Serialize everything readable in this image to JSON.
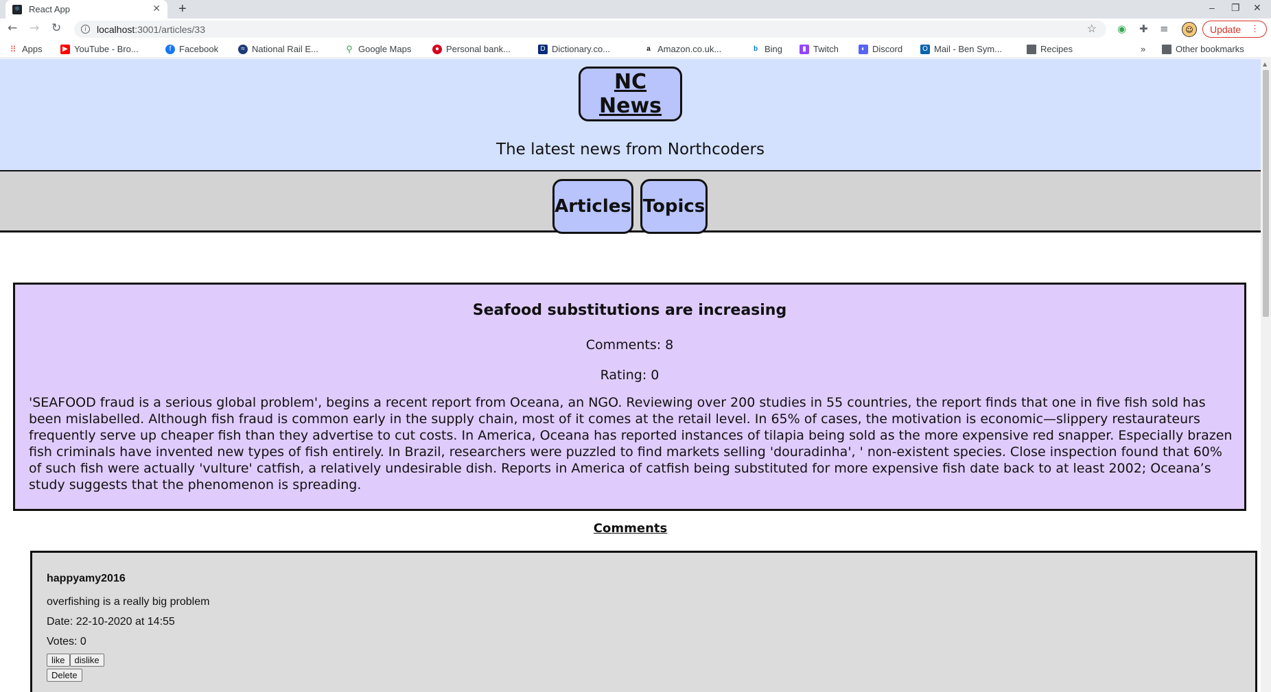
{
  "browser": {
    "tab_title": "React App",
    "url_host": "localhost",
    "url_rest": ":3001/articles/33",
    "update_label": "Update",
    "bookmarks": [
      {
        "label": "Apps",
        "icon": "apps-grid-icon",
        "color": "#4285f4"
      },
      {
        "label": "YouTube - Bro...",
        "icon": "youtube-icon",
        "color": "#ff0000"
      },
      {
        "label": "Facebook",
        "icon": "facebook-icon",
        "color": "#1877f2"
      },
      {
        "label": "National Rail E...",
        "icon": "national-rail-icon",
        "color": "#1d3a7a"
      },
      {
        "label": "Google Maps",
        "icon": "google-maps-icon",
        "color": "#34a853"
      },
      {
        "label": "Personal bank...",
        "icon": "bank-icon",
        "color": "#d6001c"
      },
      {
        "label": "Dictionary.co...",
        "icon": "dictionary-icon",
        "color": "#0a2b78"
      },
      {
        "label": "Amazon.co.uk...",
        "icon": "amazon-icon",
        "color": "#111111"
      },
      {
        "label": "Bing",
        "icon": "bing-icon",
        "color": "#0078d4"
      },
      {
        "label": "Twitch",
        "icon": "twitch-icon",
        "color": "#9146ff"
      },
      {
        "label": "Discord",
        "icon": "discord-icon",
        "color": "#5865f2"
      },
      {
        "label": "Mail - Ben Sym...",
        "icon": "outlook-icon",
        "color": "#0a64ad"
      },
      {
        "label": "Recipes",
        "icon": "folder-icon",
        "color": "#5f6368"
      }
    ],
    "more_bookmarks": "»",
    "other_bookmarks": "Other bookmarks"
  },
  "header": {
    "title": "NC News",
    "tagline": "The latest news from Northcoders"
  },
  "nav": {
    "articles_label": "Articles",
    "topics_label": "Topics"
  },
  "article": {
    "title": "Seafood substitutions are increasing",
    "comments_text": "Comments: 8",
    "rating_text": "Rating: 0",
    "body": "'SEAFOOD fraud is a serious global problem', begins a recent report from Oceana, an NGO. Reviewing over 200 studies in 55 countries, the report finds that one in five fish sold has been mislabelled. Although fish fraud is common early in the supply chain, most of it comes at the retail level. In 65% of cases, the motivation is economic—slippery restaurateurs frequently serve up cheaper fish than they advertise to cut costs. In America, Oceana has reported instances of tilapia being sold as the more expensive red snapper. Especially brazen fish criminals have invented new types of fish entirely. In Brazil, researchers were puzzled to find markets selling 'douradinha', ' non-existent species. Close inspection found that 60% of such fish were actually 'vulture' catfish, a relatively undesirable dish. Reports in America of catfish being substituted for more expensive fish date back to at least 2002; Oceana’s study suggests that the phenomenon is spreading."
  },
  "comments": {
    "heading": "Comments",
    "items": [
      {
        "author": "happyamy2016",
        "body": "overfishing is a really big problem",
        "date": "Date: 22-10-2020 at 14:55",
        "votes": "Votes: 0",
        "like_label": "like",
        "dislike_label": "dislike",
        "delete_label": "Delete"
      }
    ]
  }
}
